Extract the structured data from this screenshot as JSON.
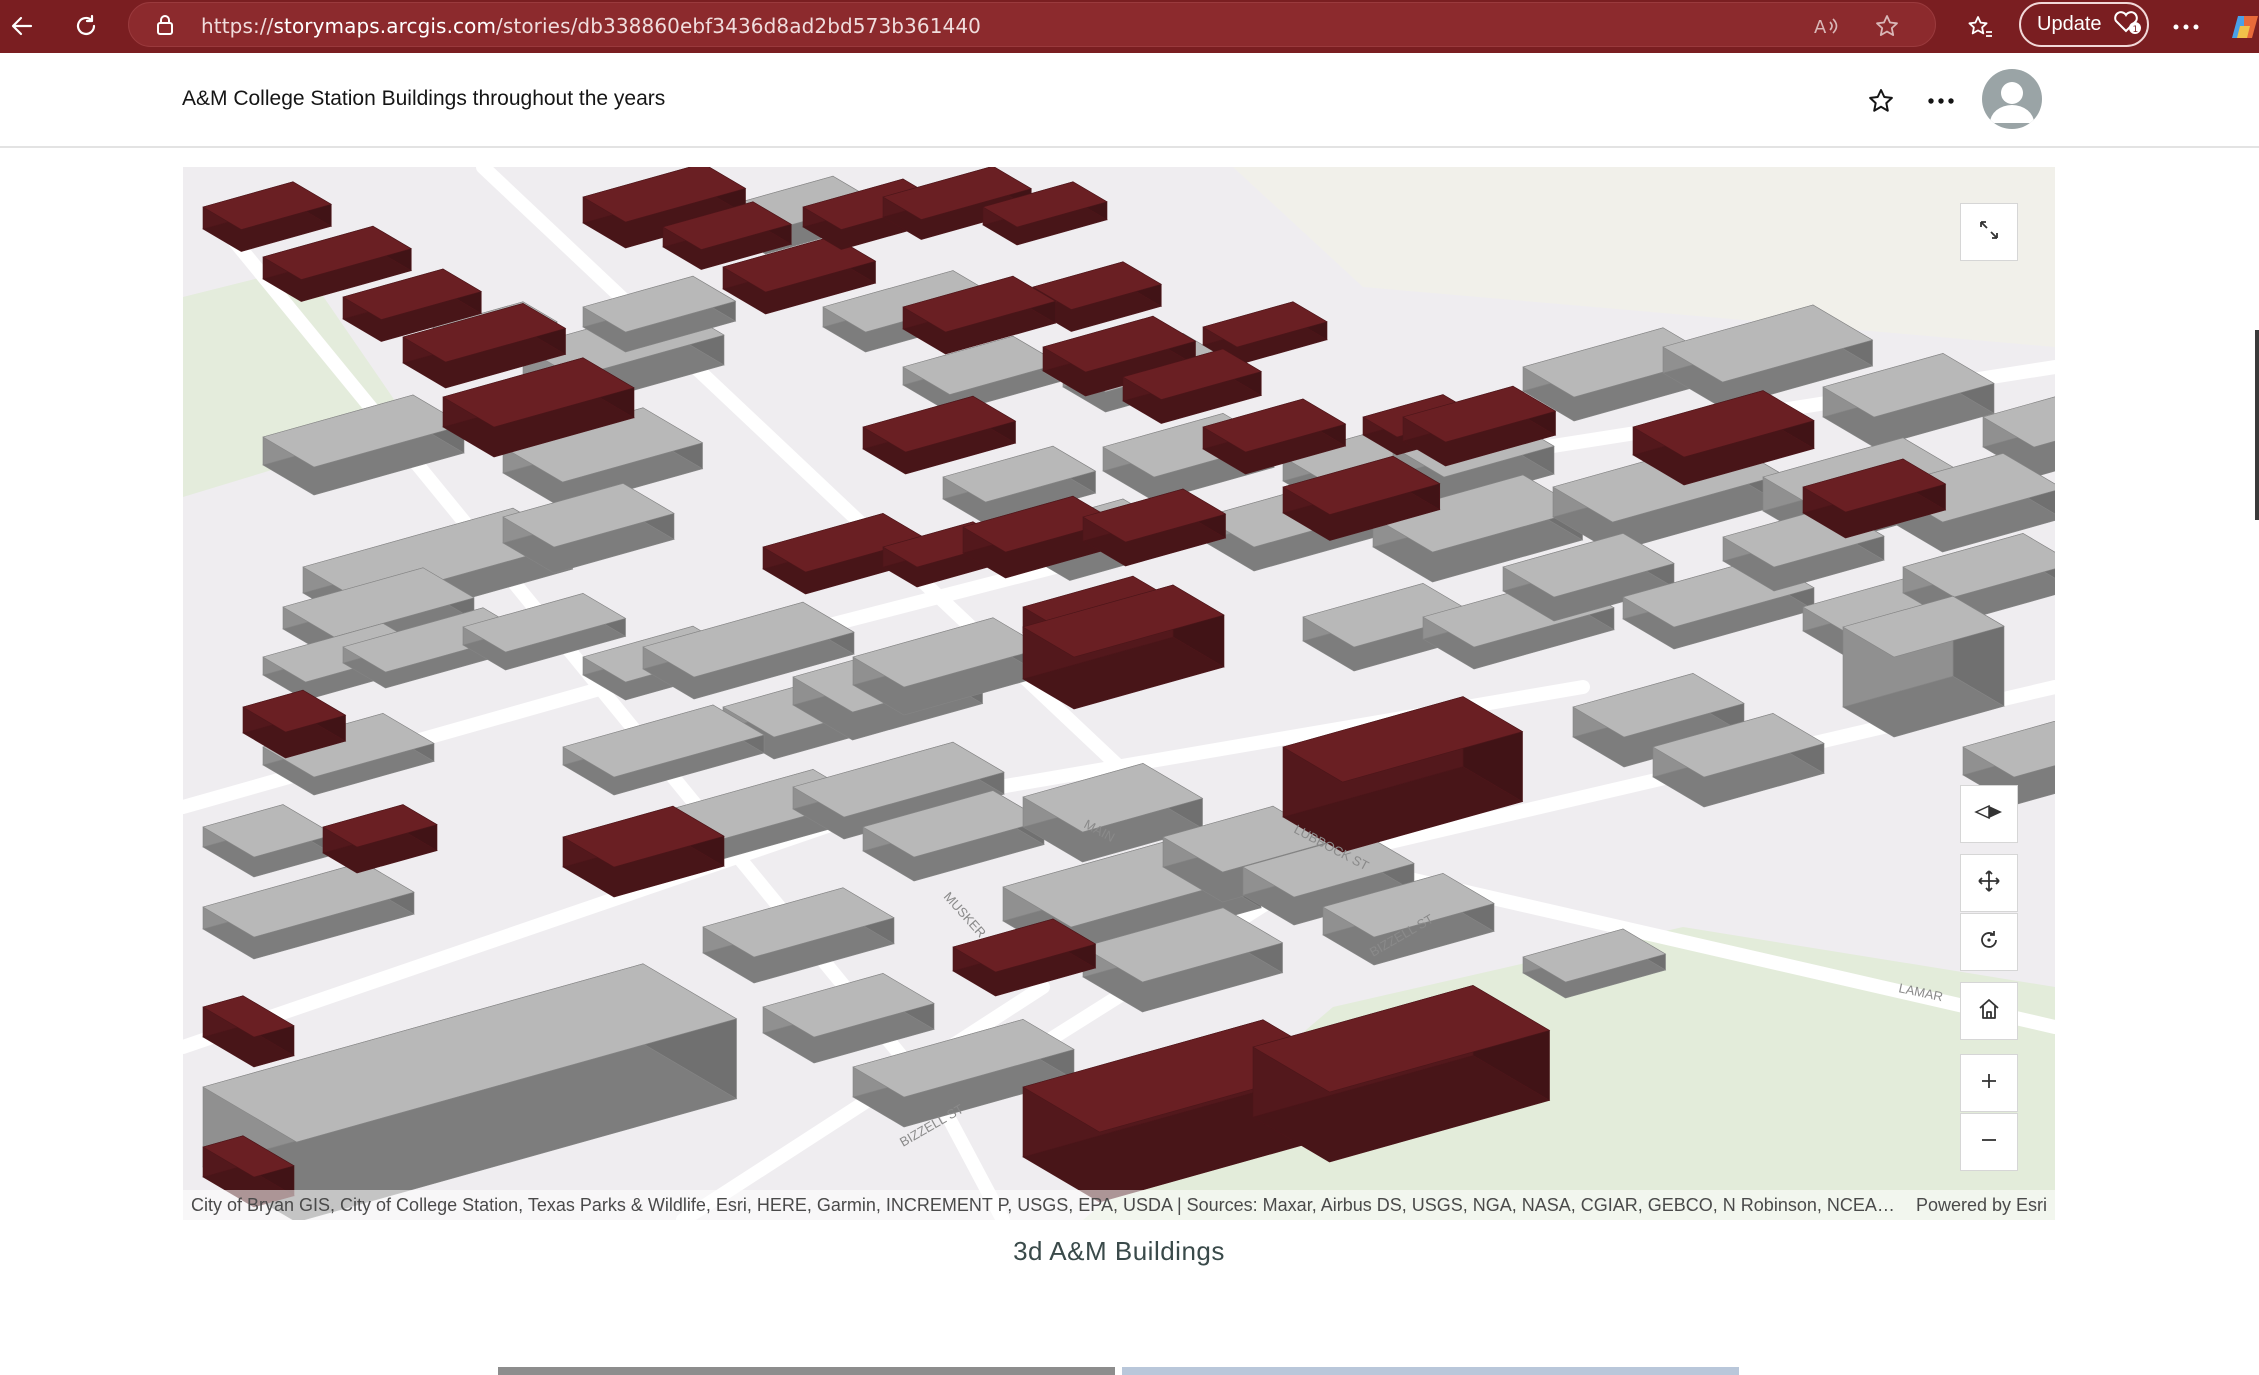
{
  "browser": {
    "url_scheme": "https://",
    "url_host": "storymaps.arcgis.com",
    "url_path": "/stories/db338860ebf3436d8ad2bd573b361440",
    "update_label": "Update",
    "icons": [
      "back-arrow-icon",
      "refresh-icon",
      "lock-icon",
      "read-aloud-icon",
      "favorite-star-icon",
      "favorites-bar-icon",
      "heart-badge-icon",
      "more-icon"
    ]
  },
  "story": {
    "title": "A&M College Station Buildings throughout the years"
  },
  "map": {
    "attribution": "City of Bryan GIS, City of College Station, Texas Parks & Wildlife, Esri, HERE, Garmin, INCREMENT P, USGS, EPA, USDA | Sources: Maxar, Airbus DS, USGS, NGA, NASA, CGIAR, GEBCO, N Robinson, NCEAS, NLS, …",
    "powered_by": "Powered by Esri",
    "street_labels": [
      "BIZZELL ST",
      "BIZZELL ST",
      "LAMAR",
      "MAIN",
      "MUSKER",
      "LUBBOCK ST"
    ],
    "controls": [
      "expand-icon",
      "compass-icon",
      "pan-icon",
      "rotate-icon",
      "home-icon",
      "zoom-in-icon",
      "zoom-out-icon"
    ],
    "colors": {
      "highlight_building": "#5a1a1e",
      "building": "#9c9c9c",
      "ground": "#efedf0",
      "green": "#e1ecd9"
    }
  },
  "caption": "3d A&M Buildings"
}
